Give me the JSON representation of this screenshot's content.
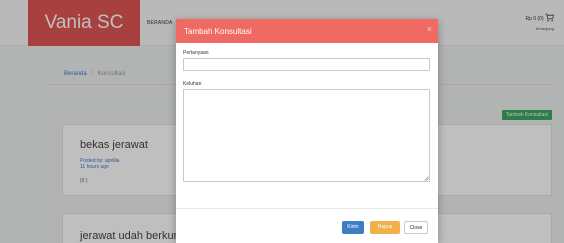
{
  "navbar": {
    "brand": "Vania SC",
    "links": [
      "BERANDA",
      "UT"
    ],
    "cart": {
      "amount": "Rp 0 (0)",
      "label": "Keranjang"
    }
  },
  "breadcrumb": {
    "home": "Beranda",
    "current": "Konsultasi"
  },
  "new_button": "Tambah Konsultasi",
  "posts": [
    {
      "title": "bekas jerawat",
      "author": "Posted by: aprillia",
      "time": "11 hours ago",
      "count": "(0 )"
    },
    {
      "title": "jerawat udah berkuran"
    }
  ],
  "modal": {
    "title": "Tambah Konsultasi",
    "close_icon": "close-icon",
    "question_label": "Pertanyaan",
    "question_value": "",
    "complaint_label": "Keluhan",
    "complaint_value": "",
    "buttons": {
      "send": "Kirim",
      "delete": "Hapus",
      "close": "Close"
    }
  },
  "colors": {
    "brand": "#e05656",
    "modal_header": "#ee6a62",
    "send": "#3d7dc4",
    "delete": "#f2b04c",
    "success": "#3aa95d"
  }
}
